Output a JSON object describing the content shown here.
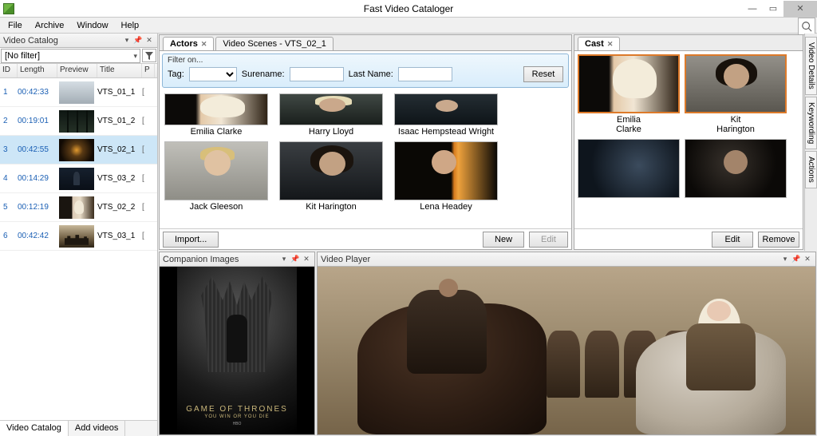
{
  "app": {
    "title": "Fast Video Cataloger"
  },
  "menu": {
    "file": "File",
    "archive": "Archive",
    "window": "Window",
    "help": "Help"
  },
  "catalog": {
    "panel_title": "Video Catalog",
    "filter_text": "[No filter]",
    "cols": {
      "id": "ID",
      "length": "Length",
      "preview": "Preview",
      "title": "Title",
      "p": "P"
    },
    "rows": [
      {
        "id": "1",
        "length": "00:42:33",
        "title": "VTS_01_1",
        "p": "[",
        "thumb": "t-snow"
      },
      {
        "id": "2",
        "length": "00:19:01",
        "title": "VTS_01_2",
        "p": "[",
        "thumb": "t-dark-trees"
      },
      {
        "id": "3",
        "length": "00:42:55",
        "title": "VTS_02_1",
        "p": "[",
        "thumb": "t-fire-map",
        "selected": true
      },
      {
        "id": "4",
        "length": "00:14:29",
        "title": "VTS_03_2",
        "p": "[",
        "thumb": "t-dark-fig"
      },
      {
        "id": "5",
        "length": "00:12:19",
        "title": "VTS_02_2",
        "p": "[",
        "thumb": "t-dany"
      },
      {
        "id": "6",
        "length": "00:42:42",
        "title": "VTS_03_1",
        "p": "[",
        "thumb": "t-castle"
      }
    ],
    "tabs": {
      "catalog": "Video Catalog",
      "add": "Add videos"
    }
  },
  "actors": {
    "tab_actors": "Actors",
    "tab_scenes": "Video Scenes - VTS_02_1",
    "filter_label": "Filter on...",
    "tag_label": "Tag:",
    "surname_label": "Surename:",
    "lastname_label": "Last Name:",
    "reset": "Reset",
    "import": "Import...",
    "new": "New",
    "edit": "Edit",
    "list_top": [
      {
        "name": "Emilia Clarke",
        "pic": "p-emilia"
      },
      {
        "name": "Harry Lloyd",
        "pic": "p-harry"
      },
      {
        "name": "Isaac Hempstead Wright",
        "pic": "p-isaac"
      }
    ],
    "list_bot": [
      {
        "name": "Jack Gleeson",
        "pic": "p-jack"
      },
      {
        "name": "Kit Harington",
        "pic": "p-kit"
      },
      {
        "name": "Lena Headey",
        "pic": "p-lena"
      }
    ]
  },
  "cast": {
    "tab": "Cast",
    "edit": "Edit",
    "remove": "Remove",
    "items": [
      {
        "name1": "Emilia",
        "name2": "Clarke",
        "pic": "p-emilia",
        "sel": true
      },
      {
        "name1": "Kit",
        "name2": "Harington",
        "pic": "p-kit2",
        "sel": true
      },
      {
        "name1": "",
        "name2": "",
        "pic": "p-dark1"
      },
      {
        "name1": "",
        "name2": "",
        "pic": "p-dark2"
      }
    ]
  },
  "vtabs": {
    "a": "Video Details",
    "b": "Keywording",
    "c": "Actions"
  },
  "companion": {
    "title": "Companion Images",
    "poster_t1": "GAME OF THRONES",
    "poster_t2": "YOU WIN OR YOU DIE",
    "poster_t3": "HBO"
  },
  "player": {
    "title": "Video Player"
  }
}
